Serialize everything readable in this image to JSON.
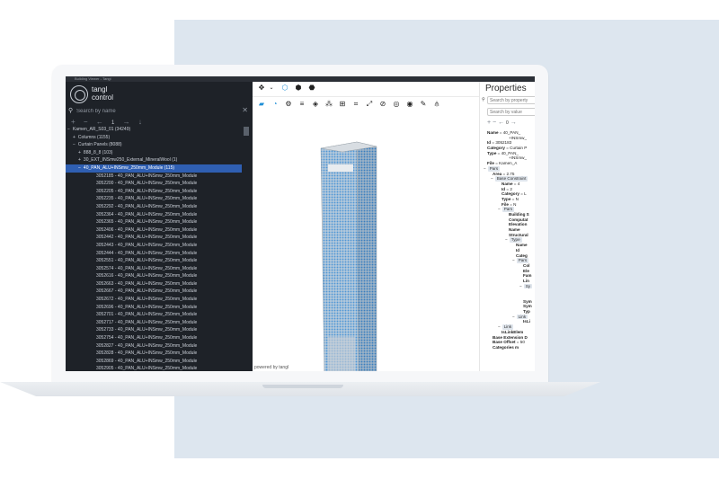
{
  "window": {
    "title": "Building Viewer - Tangl"
  },
  "brand": {
    "line1": "tangl",
    "line2": "control"
  },
  "tree_panel": {
    "search_placeholder": "Search by name",
    "nav_number": "1",
    "rows": [
      {
        "indent": 2,
        "prefix": "−",
        "text": "Kamen_AR_S03_01  (34249)"
      },
      {
        "indent": 8,
        "prefix": "+",
        "text": "Columns  (1155)"
      },
      {
        "indent": 8,
        "prefix": "−",
        "text": "Curtain Panels  (8088)"
      },
      {
        "indent": 14,
        "prefix": "+",
        "text": "888_8_8  (103)"
      },
      {
        "indent": 14,
        "prefix": "+",
        "text": "30_EXT_INSmw250_External_MineralWool  (1)"
      },
      {
        "indent": 14,
        "prefix": "−",
        "text": "40_PAN_ALU+INSmw_250mm_Module  (115)",
        "selected": true
      },
      {
        "indent": 34,
        "prefix": "",
        "text": "3052185 - 40_PAN_ALU+INSmw_250mm_Module"
      },
      {
        "indent": 34,
        "prefix": "",
        "text": "3052200 - 40_PAN_ALU+INSmw_250mm_Module"
      },
      {
        "indent": 34,
        "prefix": "",
        "text": "3052205 - 40_PAN_ALU+INSmw_250mm_Module"
      },
      {
        "indent": 34,
        "prefix": "",
        "text": "3052235 - 40_PAN_ALU+INSmw_250mm_Module"
      },
      {
        "indent": 34,
        "prefix": "",
        "text": "3052292 - 40_PAN_ALU+INSmw_250mm_Module"
      },
      {
        "indent": 34,
        "prefix": "",
        "text": "3052364 - 40_PAN_ALU+INSmw_250mm_Module"
      },
      {
        "indent": 34,
        "prefix": "",
        "text": "3052365 - 40_PAN_ALU+INSmw_250mm_Module"
      },
      {
        "indent": 34,
        "prefix": "",
        "text": "3052406 - 40_PAN_ALU+INSmw_250mm_Module"
      },
      {
        "indent": 34,
        "prefix": "",
        "text": "3052442 - 40_PAN_ALU+INSmw_250mm_Module"
      },
      {
        "indent": 34,
        "prefix": "",
        "text": "3052443 - 40_PAN_ALU+INSmw_250mm_Module"
      },
      {
        "indent": 34,
        "prefix": "",
        "text": "3052444 - 40_PAN_ALU+INSmw_250mm_Module"
      },
      {
        "indent": 34,
        "prefix": "",
        "text": "3052551 - 40_PAN_ALU+INSmw_250mm_Module"
      },
      {
        "indent": 34,
        "prefix": "",
        "text": "3052574 - 40_PAN_ALU+INSmw_250mm_Module"
      },
      {
        "indent": 34,
        "prefix": "",
        "text": "3052616 - 40_PAN_ALU+INSmw_250mm_Module"
      },
      {
        "indent": 34,
        "prefix": "",
        "text": "3052663 - 40_PAN_ALU+INSmw_250mm_Module"
      },
      {
        "indent": 34,
        "prefix": "",
        "text": "3052667 - 40_PAN_ALU+INSmw_250mm_Module"
      },
      {
        "indent": 34,
        "prefix": "",
        "text": "3052672 - 40_PAN_ALU+INSmw_250mm_Module"
      },
      {
        "indent": 34,
        "prefix": "",
        "text": "3052696 - 40_PAN_ALU+INSmw_250mm_Module"
      },
      {
        "indent": 34,
        "prefix": "",
        "text": "3052701 - 40_PAN_ALU+INSmw_250mm_Module"
      },
      {
        "indent": 34,
        "prefix": "",
        "text": "3052717 - 40_PAN_ALU+INSmw_250mm_Module"
      },
      {
        "indent": 34,
        "prefix": "",
        "text": "3052733 - 40_PAN_ALU+INSmw_250mm_Module"
      },
      {
        "indent": 34,
        "prefix": "",
        "text": "3052754 - 40_PAN_ALU+INSmw_250mm_Module"
      },
      {
        "indent": 34,
        "prefix": "",
        "text": "3052827 - 40_PAN_ALU+INSmw_250mm_Module"
      },
      {
        "indent": 34,
        "prefix": "",
        "text": "3052828 - 40_PAN_ALU+INSmw_250mm_Module"
      },
      {
        "indent": 34,
        "prefix": "",
        "text": "3052869 - 40_PAN_ALU+INSmw_250mm_Module"
      },
      {
        "indent": 34,
        "prefix": "",
        "text": "3052905 - 40_PAN_ALU+INSmw_250mm_Module"
      },
      {
        "indent": 34,
        "prefix": "",
        "text": "3052906 - 40_PAN_ALU+INSmw_250mm_Module"
      }
    ]
  },
  "viewport": {
    "powered_by": "powered by tangl"
  },
  "properties": {
    "title": "Properties",
    "window_controls": "—   □   ✕",
    "search_property_placeholder": "Search by property",
    "search_value_placeholder": "Search by value",
    "nav_number": "0",
    "lines": [
      {
        "indent": 6,
        "key": "Name",
        "val": "= 40_PAN_"
      },
      {
        "indent": 30,
        "key": "",
        "val": "+INSmw_"
      },
      {
        "indent": 6,
        "key": "Id",
        "val": "= 3052183"
      },
      {
        "indent": 6,
        "key": "Category",
        "val": "= Curtain P"
      },
      {
        "indent": 6,
        "key": "Type",
        "val": "= 40_PAN_"
      },
      {
        "indent": 30,
        "key": "",
        "val": "+INSmw_"
      },
      {
        "indent": 6,
        "key": "File",
        "val": "= Kamen_A"
      },
      {
        "indent": 2,
        "tag": "Pars",
        "prefix": "−"
      },
      {
        "indent": 12,
        "key": "Area",
        "val": "= 2.75"
      },
      {
        "indent": 10,
        "tag": "Base Constraint",
        "prefix": "−"
      },
      {
        "indent": 22,
        "key": "Name",
        "val": "= 4"
      },
      {
        "indent": 22,
        "key": "Id",
        "val": "= 2"
      },
      {
        "indent": 22,
        "key": "Category",
        "val": "= L"
      },
      {
        "indent": 22,
        "key": "Type",
        "val": "= N"
      },
      {
        "indent": 22,
        "key": "File",
        "val": "= N"
      },
      {
        "indent": 18,
        "tag": "Pars",
        "prefix": "−"
      },
      {
        "indent": 30,
        "key": "Building S",
        "val": ""
      },
      {
        "indent": 30,
        "key": "Computat",
        "val": ""
      },
      {
        "indent": 30,
        "key": "Elevation",
        "val": ""
      },
      {
        "indent": 30,
        "key": "Name",
        "val": ""
      },
      {
        "indent": 30,
        "key": "Structural",
        "val": ""
      },
      {
        "indent": 26,
        "tag": "Type",
        "prefix": "−"
      },
      {
        "indent": 38,
        "key": "Name",
        "val": ""
      },
      {
        "indent": 38,
        "key": "Id",
        "val": ""
      },
      {
        "indent": 38,
        "key": "Categ",
        "val": ""
      },
      {
        "indent": 34,
        "tag": "Pars",
        "prefix": "−"
      },
      {
        "indent": 46,
        "key": "Col",
        "val": ""
      },
      {
        "indent": 46,
        "key": "Ele",
        "val": ""
      },
      {
        "indent": 46,
        "key": "Fam",
        "val": ""
      },
      {
        "indent": 46,
        "key": "Lin",
        "val": ""
      },
      {
        "indent": 42,
        "tag": "Sy",
        "prefix": "−"
      },
      {
        "indent": 46,
        "key": "",
        "val": ""
      },
      {
        "indent": 46,
        "key": "",
        "val": ""
      },
      {
        "indent": 46,
        "key": "Sym",
        "val": ""
      },
      {
        "indent": 46,
        "key": "Sym",
        "val": ""
      },
      {
        "indent": 46,
        "key": "Typ",
        "val": ""
      },
      {
        "indent": 34,
        "tag": "Link",
        "prefix": "−"
      },
      {
        "indent": 46,
        "key": "IsLi",
        "val": ""
      },
      {
        "indent": 18,
        "tag": "Link",
        "prefix": "−"
      },
      {
        "indent": 22,
        "key": "IsLinkElem",
        "val": ""
      },
      {
        "indent": 12,
        "key": "Base Extension D",
        "val": ""
      },
      {
        "indent": 12,
        "key": "Base Offset",
        "val": "= 50"
      },
      {
        "indent": 12,
        "key": "Categories m",
        "val": ""
      }
    ]
  },
  "colors": {
    "sidebar": "#1e2228",
    "selection": "#2f5fb2",
    "accent": "#1f8fd6",
    "backdrop": "#dde6ef"
  }
}
